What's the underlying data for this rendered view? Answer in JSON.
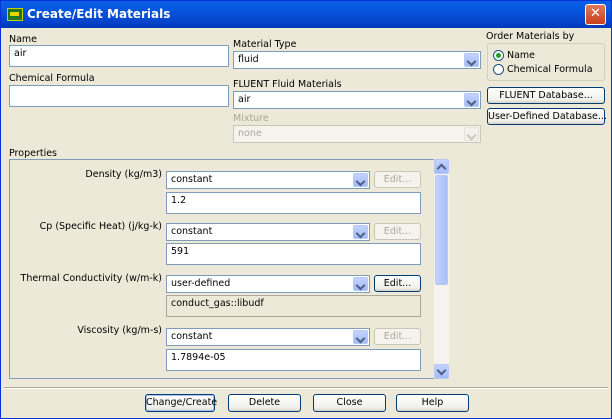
{
  "window": {
    "title": "Create/Edit Materials",
    "close_glyph": "✕"
  },
  "name": {
    "label": "Name",
    "value": "air"
  },
  "chemical_formula": {
    "label": "Chemical Formula",
    "value": ""
  },
  "material_type": {
    "label": "Material Type",
    "value": "fluid"
  },
  "fluent_fluid_materials": {
    "label": "FLUENT Fluid Materials",
    "value": "air"
  },
  "mixture": {
    "label": "Mixture",
    "value": "none"
  },
  "order_by": {
    "label": "Order Materials by",
    "options": [
      {
        "label": "Name",
        "selected": true
      },
      {
        "label": "Chemical Formula",
        "selected": false
      }
    ]
  },
  "db_buttons": {
    "fluent_db": "FLUENT Database...",
    "user_db": "User-Defined Database..."
  },
  "properties": {
    "label": "Properties",
    "items": [
      {
        "label": "Density (kg/m3)",
        "method": "constant",
        "value": "1.2",
        "edit": "Edit...",
        "edit_enabled": false,
        "value_editable": true
      },
      {
        "label": "Cp (Specific Heat) (j/kg-k)",
        "method": "constant",
        "value": "591",
        "edit": "Edit...",
        "edit_enabled": false,
        "value_editable": true
      },
      {
        "label": "Thermal Conductivity (w/m-k)",
        "method": "user-defined",
        "value": "conduct_gas::libudf",
        "edit": "Edit...",
        "edit_enabled": true,
        "value_editable": false
      },
      {
        "label": "Viscosity (kg/m-s)",
        "method": "constant",
        "value": "1.7894e-05",
        "edit": "Edit...",
        "edit_enabled": false,
        "value_editable": true
      }
    ]
  },
  "footer": {
    "change_create": "Change/Create",
    "delete": "Delete",
    "close": "Close",
    "help": "Help"
  }
}
